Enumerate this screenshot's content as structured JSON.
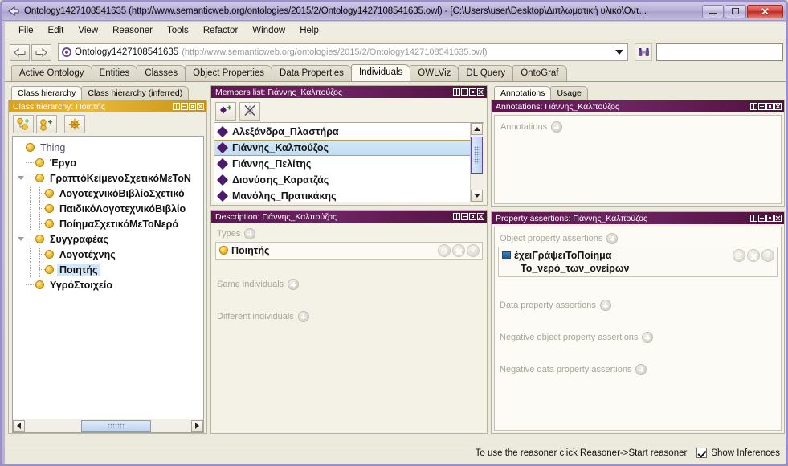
{
  "window": {
    "title": "Ontology1427108541635 (http://www.semanticweb.org/ontologies/2015/2/Ontology1427108541635.owl) - [C:\\Users\\user\\Desktop\\Διπλωματική υλικό\\Οντ...",
    "minimize_label": "Minimize",
    "maximize_label": "Restore",
    "close_label": "Close"
  },
  "menubar": {
    "items": [
      {
        "label": "File"
      },
      {
        "label": "Edit"
      },
      {
        "label": "View"
      },
      {
        "label": "Reasoner"
      },
      {
        "label": "Tools"
      },
      {
        "label": "Refactor"
      },
      {
        "label": "Window"
      },
      {
        "label": "Help"
      }
    ]
  },
  "navbar": {
    "back_label": "Back",
    "forward_label": "Forward",
    "ontology_name": "Ontology1427108541635",
    "ontology_uri": "(http://www.semanticweb.org/ontologies/2015/2/Ontology1427108541635.owl)",
    "search_icon": "binoculars-icon",
    "search_value": "",
    "search_placeholder": ""
  },
  "tabs": {
    "items": [
      {
        "label": "Active Ontology",
        "active": false
      },
      {
        "label": "Entities",
        "active": false
      },
      {
        "label": "Classes",
        "active": false
      },
      {
        "label": "Object Properties",
        "active": false
      },
      {
        "label": "Data Properties",
        "active": false
      },
      {
        "label": "Individuals",
        "active": true
      },
      {
        "label": "OWLViz",
        "active": false
      },
      {
        "label": "DL Query",
        "active": false
      },
      {
        "label": "OntoGraf",
        "active": false
      }
    ]
  },
  "class_hierarchy": {
    "subtabs": [
      {
        "label": "Class hierarchy",
        "active": true
      },
      {
        "label": "Class hierarchy (inferred)",
        "active": false
      }
    ],
    "panel_title": "Class hierarchy: Ποιητής",
    "toolbar": [
      {
        "name": "add-subclass-button",
        "label": "Add subclass"
      },
      {
        "name": "add-sibling-class-button",
        "label": "Add sibling class"
      },
      {
        "name": "delete-class-button",
        "label": "Delete class"
      }
    ],
    "tree": [
      {
        "label": "Thing",
        "depth": 0,
        "expanded": true,
        "selected": false,
        "bold": false
      },
      {
        "label": "Έργο",
        "depth": 1,
        "expanded": false,
        "selected": false,
        "bold": true
      },
      {
        "label": "ΓραπτόΚείμενοΣχετικόΜεΤοΝ",
        "depth": 1,
        "expanded": true,
        "selected": false,
        "bold": true
      },
      {
        "label": "ΛογοτεχνικόΒιβλίοΣχετικό",
        "depth": 2,
        "expanded": false,
        "selected": false,
        "bold": true
      },
      {
        "label": "ΠαιδικόΛογοτεχνικόΒιβλίο",
        "depth": 2,
        "expanded": false,
        "selected": false,
        "bold": true
      },
      {
        "label": "ΠοίημαΣχετικόΜεΤοΝερό",
        "depth": 2,
        "expanded": false,
        "selected": false,
        "bold": true
      },
      {
        "label": "Συγγραφέας",
        "depth": 1,
        "expanded": true,
        "selected": false,
        "bold": true
      },
      {
        "label": "Λογοτέχνης",
        "depth": 2,
        "expanded": false,
        "selected": false,
        "bold": true
      },
      {
        "label": "Ποιητής",
        "depth": 2,
        "expanded": false,
        "selected": true,
        "bold": true
      },
      {
        "label": "ΥγρόΣτοιχείο",
        "depth": 1,
        "expanded": false,
        "selected": false,
        "bold": true
      }
    ]
  },
  "members_list": {
    "panel_title": "Members list: Γιάννης_Καλπούζος",
    "toolbar": [
      {
        "name": "add-individual-button",
        "label": "Add individual"
      },
      {
        "name": "delete-individual-button",
        "label": "Delete individual"
      }
    ],
    "items": [
      {
        "label": "Αλεξάνδρα_Πλαστήρα",
        "selected": false
      },
      {
        "label": "Γιάννης_Καλπούζος",
        "selected": true
      },
      {
        "label": "Γιάννης_Πελίτης",
        "selected": false
      },
      {
        "label": "Διονύσης_Καρατζάς",
        "selected": false
      },
      {
        "label": "Μανόλης_Πρατικάκης",
        "selected": false
      }
    ]
  },
  "description": {
    "panel_title": "Description: Γιάννης_Καλπούζος",
    "sections": [
      {
        "title": "Types",
        "values": [
          {
            "label": "Ποιητής",
            "kind": "class"
          }
        ]
      },
      {
        "title": "Same individuals",
        "values": []
      },
      {
        "title": "Different individuals",
        "values": []
      }
    ]
  },
  "annotations": {
    "subtabs": [
      {
        "label": "Annotations",
        "active": true
      },
      {
        "label": "Usage",
        "active": false
      }
    ],
    "panel_title": "Annotations: Γιάννης_Καλπούζος",
    "section_title": "Annotations",
    "values": []
  },
  "property_assertions": {
    "panel_title": "Property assertions: Γιάννης_Καλπούζος",
    "sections": [
      {
        "title": "Object property assertions",
        "values": [
          {
            "property": "έχειΓράψειΤοΠοίημα",
            "filler": "Το_νερό_των_ονείρων",
            "kind": "object-property"
          }
        ]
      },
      {
        "title": "Data property assertions",
        "values": []
      },
      {
        "title": "Negative object property assertions",
        "values": []
      },
      {
        "title": "Negative data property assertions",
        "values": []
      }
    ]
  },
  "statusbar": {
    "message": "To use the reasoner click Reasoner->Start reasoner",
    "show_inferences_label": "Show Inferences",
    "show_inferences_checked": true
  },
  "colors": {
    "panel_header": "#5d1550",
    "class_header": "#d8a21a",
    "class_icon": "#f0c33c",
    "individual_icon": "#4b1a6f",
    "object_property_icon": "#2e6db0",
    "selection": "#c2ddf2",
    "window_frame": "#9a90c4"
  }
}
